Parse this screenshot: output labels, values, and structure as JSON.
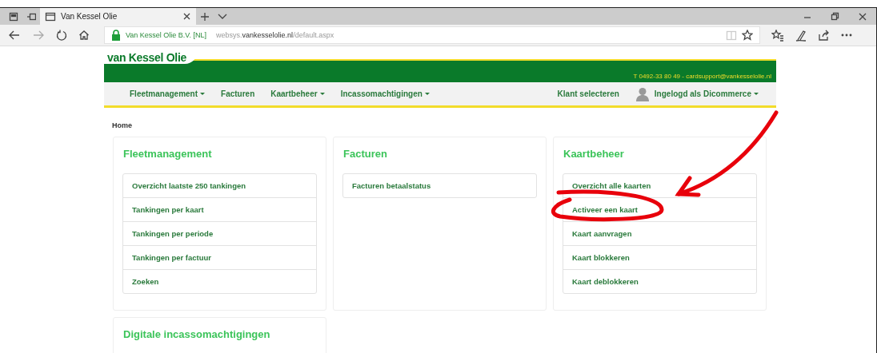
{
  "browser": {
    "tabs": [
      {
        "title": "Van Kessel Olie",
        "selected": true
      }
    ],
    "address_bar": {
      "site_identity": "Van Kessel Olie B.V. [NL]",
      "url_prefix": "websys.",
      "url_domain": "vankesselolie.nl",
      "url_path": "/default.aspx"
    }
  },
  "site": {
    "logo": "van Kessel Olie",
    "contact": "T 0492-33 80 49 - cardsupport@vankesselolie.nl",
    "nav": [
      {
        "label": "Fleetmanagement",
        "dropdown": true
      },
      {
        "label": "Facturen",
        "dropdown": false
      },
      {
        "label": "Kaartbeheer",
        "dropdown": true
      },
      {
        "label": "Incassomachtigingen",
        "dropdown": true
      }
    ],
    "nav_right": [
      {
        "kind": "link",
        "label": "Klant selecteren",
        "dropdown": false
      },
      {
        "kind": "user",
        "label": "Ingelogd als Dicommerce",
        "dropdown": true
      }
    ],
    "breadcrumb": "Home",
    "panels": [
      {
        "title": "Fleetmanagement",
        "items": [
          "Overzicht laatste 250 tankingen",
          "Tankingen per kaart",
          "Tankingen per periode",
          "Tankingen per factuur",
          "Zoeken"
        ]
      },
      {
        "title": "Facturen",
        "items": [
          "Facturen betaalstatus"
        ]
      },
      {
        "title": "Kaartbeheer",
        "items": [
          "Overzicht alle kaarten",
          "Activeer een kaart",
          "Kaart aanvragen",
          "Kaart blokkeren",
          "Kaart deblokkeren"
        ]
      },
      {
        "title": "Digitale incassomachtigingen"
      }
    ]
  },
  "annotation_arrow": {
    "color": "#e8000b"
  },
  "annotation_loop": {
    "color": "#e8000b"
  }
}
